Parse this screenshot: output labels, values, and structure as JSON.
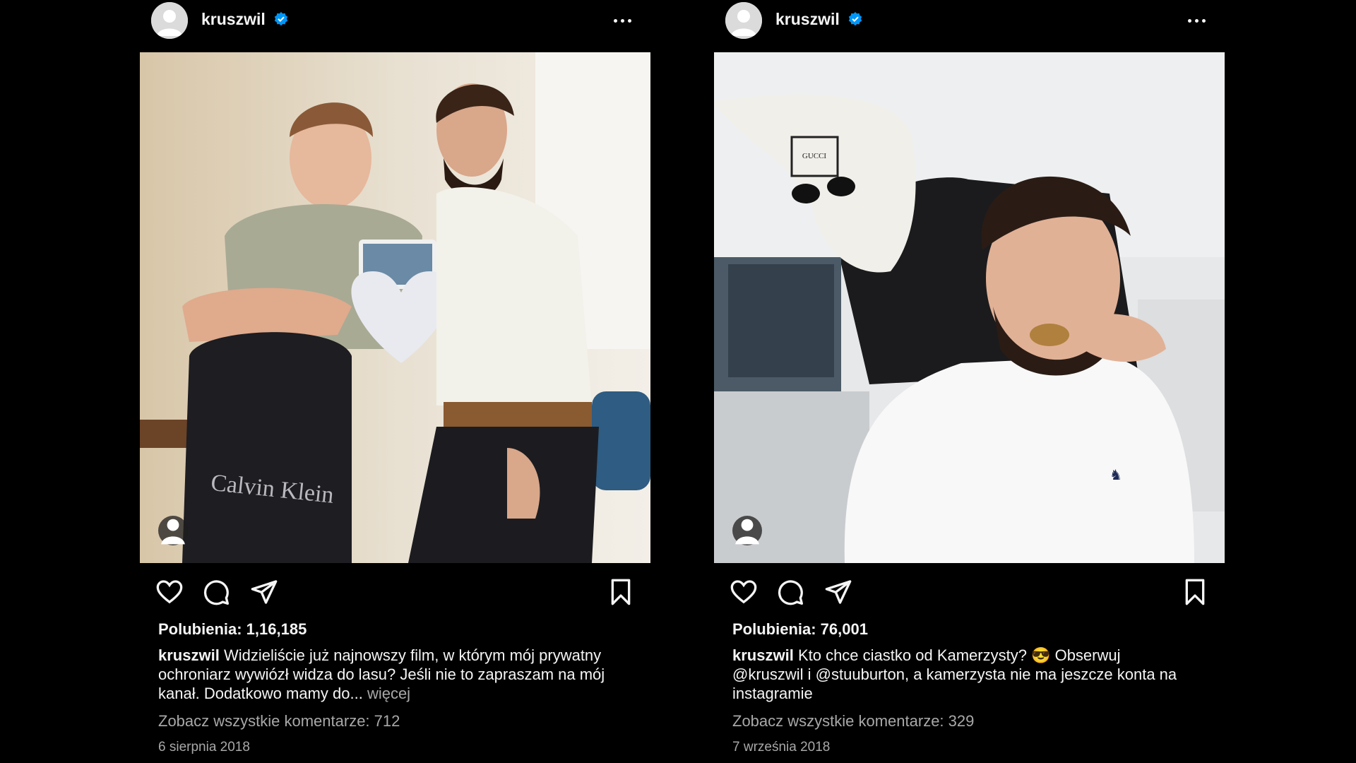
{
  "posts": [
    {
      "username": "kruszwil",
      "verified": true,
      "likes": "Polubienia: 1,16,185",
      "caption_user": "kruszwil",
      "caption_text": "Widzieliście już najnowszy film, w którym mój prywatny ochroniarz wywiózł widza do lasu? Jeśli nie to zapraszam na mój kanał. Dodatkowo mamy do...",
      "more_label": "więcej",
      "comments": "Zobacz wszystkie komentarze: 712",
      "date": "6 sierpnia 2018",
      "photo_text": "Calvin Klein"
    },
    {
      "username": "kruszwil",
      "verified": true,
      "likes": "Polubienia: 76,001",
      "caption_user": "kruszwil",
      "caption_text": "Kto chce ciastko od Kamerzysty? 😎 Obserwuj @kruszwil i @stuuburton, a kamerzysta nie ma jeszcze konta na instagramie",
      "more_label": "",
      "comments": "Zobacz wszystkie komentarze: 329",
      "date": "7 września 2018",
      "photo_text": "GUCCI"
    }
  ],
  "icons": {
    "more": "more-options-icon",
    "like": "heart-icon",
    "comment": "comment-bubble-icon",
    "share": "paper-plane-icon",
    "save": "bookmark-icon",
    "tag": "person-tag-icon",
    "verified": "verified-badge-icon"
  },
  "colors": {
    "background": "#000000",
    "text": "#f5f5f5",
    "muted": "#a8a8a8",
    "verified": "#0095f6"
  }
}
